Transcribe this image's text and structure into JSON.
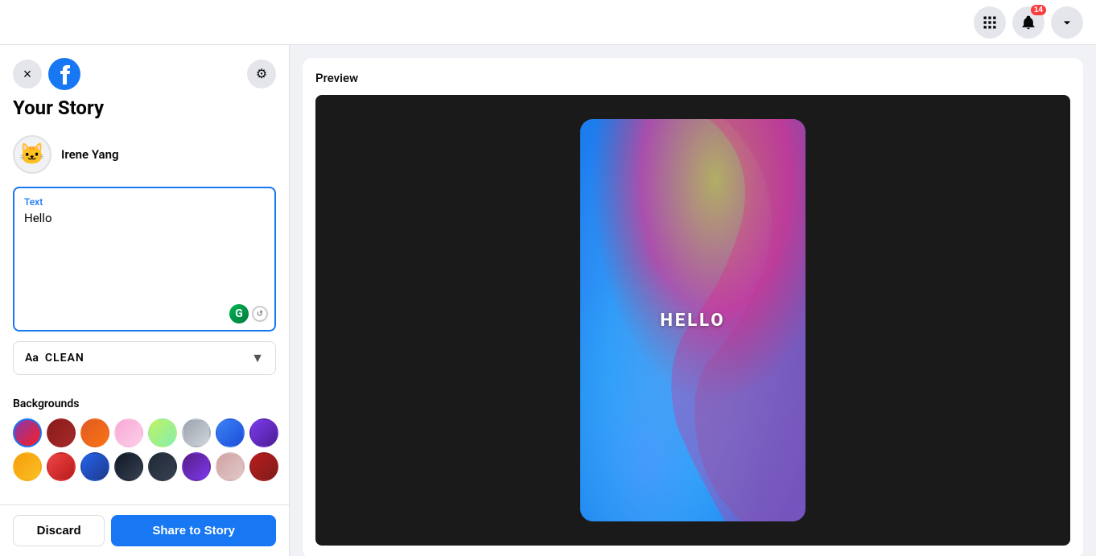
{
  "topNav": {
    "gridIconLabel": "grid-icon",
    "notificationIconLabel": "notification-icon",
    "notificationCount": "14",
    "accountIconLabel": "account-icon"
  },
  "sidebar": {
    "title": "Your Story",
    "closeButtonLabel": "×",
    "gearIconLabel": "⚙",
    "user": {
      "name": "Irene Yang",
      "avatarEmoji": "🐱"
    },
    "textField": {
      "label": "Text",
      "value": "Hello",
      "placeholder": ""
    },
    "fontSelector": {
      "prefix": "Aa",
      "fontName": "CLEAN",
      "dropdownLabel": "▼"
    },
    "backgrounds": {
      "label": "Backgrounds",
      "swatches": [
        {
          "color": "#c13584",
          "gradient": "linear-gradient(135deg, #833ab4, #fd1d1d)"
        },
        {
          "color": "#8b1a1a",
          "gradient": "linear-gradient(135deg, #8b1a1a, #a52a2a)"
        },
        {
          "color": "#e05a22",
          "gradient": "linear-gradient(135deg, #e05a22, #f97316)"
        },
        {
          "color": "#f9a8d4",
          "gradient": "linear-gradient(135deg, #f9a8d4, #fbcfe8)"
        },
        {
          "color": "#bef264",
          "gradient": "linear-gradient(135deg, #bef264, #86efac)"
        },
        {
          "color": "#9ca3af",
          "gradient": "linear-gradient(135deg, #9ca3af, #d1d5db)"
        },
        {
          "color": "#3b82f6",
          "gradient": "linear-gradient(135deg, #3b82f6, #1d4ed8)"
        },
        {
          "color": "#7c3aed",
          "gradient": "linear-gradient(135deg, #7c3aed, #4c1d95)"
        },
        {
          "color": "#f59e0b",
          "gradient": "linear-gradient(135deg, #f59e0b, #fbbf24)"
        },
        {
          "color": "#ef4444",
          "gradient": "linear-gradient(135deg, #ef4444, #b91c1c)"
        },
        {
          "color": "#2563eb",
          "gradient": "linear-gradient(135deg, #2563eb, #1e3a8a)"
        },
        {
          "color": "#111827",
          "gradient": "linear-gradient(135deg, #111827, #374151)"
        },
        {
          "color": "#1f2937",
          "gradient": "linear-gradient(135deg, #1f2937, #374151)"
        },
        {
          "color": "#581c87",
          "gradient": "linear-gradient(135deg, #581c87, #7c3aed)"
        },
        {
          "color": "#d1a3a4",
          "gradient": "linear-gradient(135deg, #d1a3a4, #e0c8c8)"
        },
        {
          "color": "#b91c1c",
          "gradient": "linear-gradient(135deg, #b91c1c, #7f1d1d)"
        }
      ]
    },
    "footer": {
      "discardLabel": "Discard",
      "shareLabel": "Share to Story"
    }
  },
  "preview": {
    "label": "Preview",
    "storyText": "HELLO"
  }
}
